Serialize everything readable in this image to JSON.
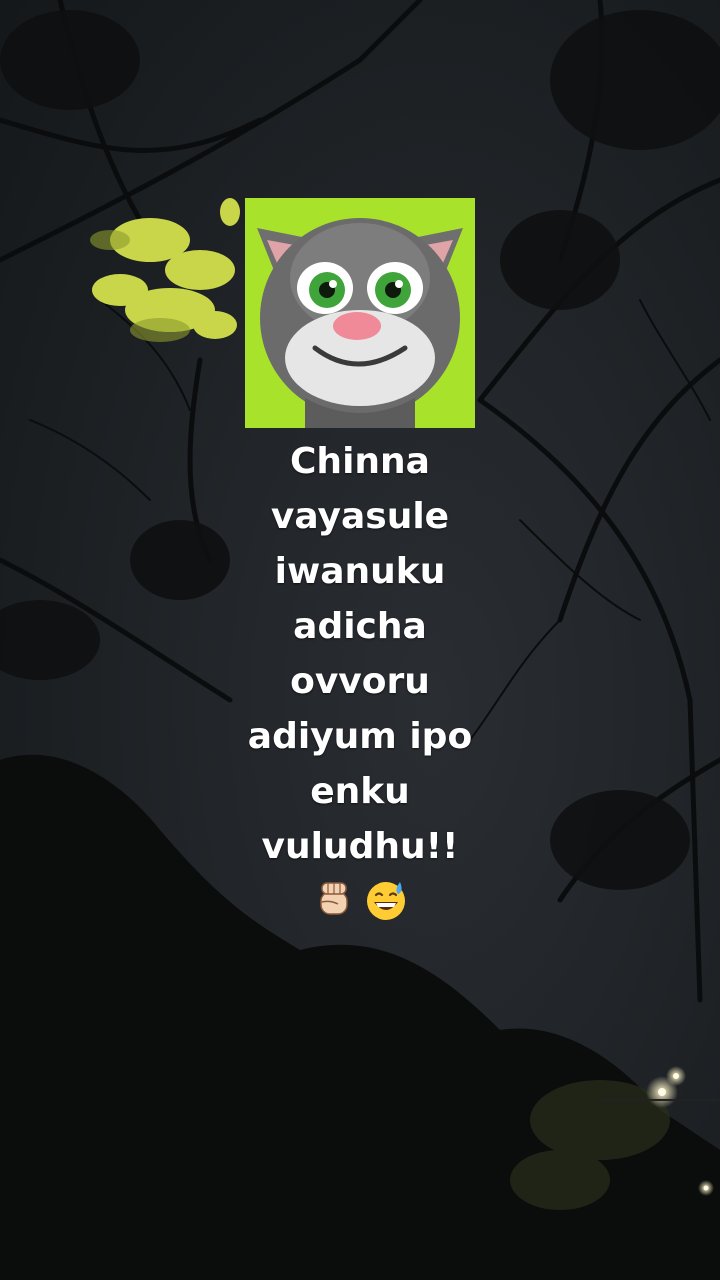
{
  "caption": {
    "lines": [
      "Chinna",
      "vayasule",
      "iwanuku",
      "adicha",
      "ovvoru",
      "adiyum ipo",
      "enku",
      "vuludhu!!"
    ]
  },
  "emojis": [
    "raised-fist-icon",
    "grinning-sweat-icon"
  ],
  "colors": {
    "sky": "#1c1f22",
    "foliage_lit": "#c9d64a",
    "tile_bg": "#a9e22a",
    "text": "#ffffff"
  }
}
